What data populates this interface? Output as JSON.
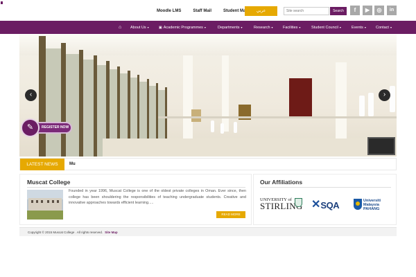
{
  "top_bar": {
    "links": [
      "Moodle LMS",
      "Staff Mail",
      "Student Mail"
    ],
    "arabic_label": "عربي",
    "search_placeholder": "Site search",
    "search_button": "Search",
    "social_icons": [
      "facebook-icon",
      "youtube-icon",
      "instagram-icon",
      "linkedin-icon"
    ]
  },
  "nav": {
    "items": [
      {
        "label": "About Us",
        "icon": "",
        "caret": "▾"
      },
      {
        "label": "Academic Programmes",
        "icon": "book-icon",
        "caret": "▾"
      },
      {
        "label": "Departments",
        "icon": "",
        "caret": "▾"
      },
      {
        "label": "Research",
        "icon": "",
        "caret": "▾"
      },
      {
        "label": "Facilities",
        "icon": "",
        "caret": "▾"
      },
      {
        "label": "Student Council",
        "icon": "",
        "caret": "▾"
      },
      {
        "label": "Events",
        "icon": "",
        "caret": "▾"
      },
      {
        "label": "Contact",
        "icon": "",
        "caret": "▾"
      }
    ],
    "home_icon": "home-icon"
  },
  "hero": {
    "prev_icon": "chevron-left-icon",
    "next_icon": "chevron-right-icon",
    "register_label": "REGISTER NOW",
    "register_icon": "edit-icon"
  },
  "news": {
    "label": "LATEST NEWS",
    "ticker": "Mu"
  },
  "about": {
    "title": "Muscat College",
    "text": "Founded in year 1996, Muscat College is one of the oldest private colleges in Oman. Ever since, then college has been shouldering the responsibilities of teaching undergraduate students. Creative and innovative approaches towards efficient learning.....",
    "read_more": "READ MORE"
  },
  "affiliations": {
    "title": "Our Affiliations",
    "stirling": {
      "line1": "UNIVERSITY of",
      "line2": "STIRLING"
    },
    "sqa": {
      "mark": "✕",
      "text": "SQA"
    },
    "ump": {
      "line1": "Universiti",
      "line2": "Malaysia",
      "line3": "PAHANG"
    }
  },
  "footer": {
    "copyright": "Copyright © 2015 Muscat College . All rights reserved.",
    "sitemap": "Site Map"
  },
  "colors": {
    "brand_purple": "#6b1d63",
    "accent_gold": "#e6a902"
  }
}
